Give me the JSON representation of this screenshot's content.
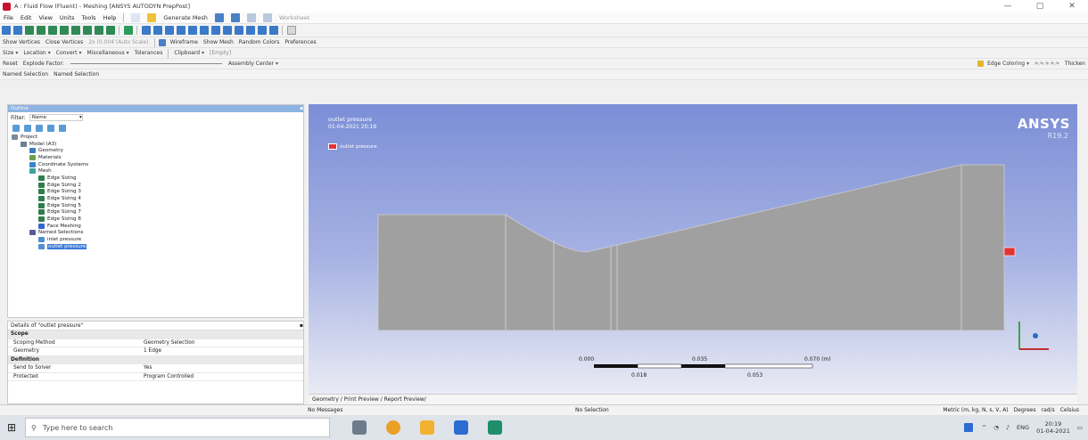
{
  "window": {
    "title": "A : Fluid Flow (Fluent) - Meshing [ANSYS AUTODYN PrepPost]",
    "controls": [
      "—",
      "▢",
      "✕"
    ]
  },
  "menubar": [
    "File",
    "Edit",
    "View",
    "Units",
    "Tools",
    "Help"
  ],
  "toolbar1": {
    "generate_mesh": "Generate Mesh",
    "worksheet": "Worksheet"
  },
  "toolbar3": {
    "show_vertices": "Show Vertices",
    "close_vertices": "Close Vertices",
    "auto_scale": "2x (0.004 (Auto Scale)",
    "wireframe": "Wireframe",
    "show_mesh": "Show Mesh",
    "random_colors": "Random Colors",
    "preferences": "Preferences"
  },
  "toolbar4": {
    "size": "Size",
    "location": "Location",
    "convert": "Convert",
    "miscellaneous": "Miscellaneous",
    "tolerances": "Tolerances",
    "clipboard": "Clipboard",
    "empty": "[Empty]"
  },
  "toolbar5": {
    "reset": "Reset",
    "explode_factor": "Explode Factor:",
    "assembly_center": "Assembly Center",
    "edge_coloring": "Edge Coloring",
    "thicken": "Thicken"
  },
  "named_selection_bar": {
    "named_selection": "Named Selection",
    "new_named_selection": "Named Selection"
  },
  "outline": {
    "title": "Outline",
    "filter_label": "Filter:",
    "filter_value": "Name",
    "tree": [
      {
        "label": "Project",
        "indent": 0,
        "icon": "project-icon",
        "color": "#7a8a9a"
      },
      {
        "label": "Model (A3)",
        "indent": 1,
        "icon": "model-icon",
        "color": "#6a7f95"
      },
      {
        "label": "Geometry",
        "indent": 2,
        "icon": "geometry-icon",
        "color": "#3d7bbf"
      },
      {
        "label": "Materials",
        "indent": 2,
        "icon": "materials-icon",
        "color": "#6f9e4f"
      },
      {
        "label": "Coordinate Systems",
        "indent": 2,
        "icon": "coordinate-icon",
        "color": "#3a86c9"
      },
      {
        "label": "Mesh",
        "indent": 2,
        "icon": "mesh-icon",
        "color": "#3aa39a"
      },
      {
        "label": "Edge Sizing",
        "indent": 3,
        "icon": "sizing-icon",
        "color": "#2f7d4a"
      },
      {
        "label": "Edge Sizing 2",
        "indent": 3,
        "icon": "sizing-icon",
        "color": "#2f7d4a"
      },
      {
        "label": "Edge Sizing 3",
        "indent": 3,
        "icon": "sizing-icon",
        "color": "#2f7d4a"
      },
      {
        "label": "Edge Sizing 4",
        "indent": 3,
        "icon": "sizing-icon",
        "color": "#2f7d4a"
      },
      {
        "label": "Edge Sizing 5",
        "indent": 3,
        "icon": "sizing-icon",
        "color": "#2f7d4a"
      },
      {
        "label": "Edge Sizing 7",
        "indent": 3,
        "icon": "sizing-icon",
        "color": "#2f7d4a"
      },
      {
        "label": "Edge Sizing 8",
        "indent": 3,
        "icon": "sizing-icon",
        "color": "#2f7d4a"
      },
      {
        "label": "Face Meshing",
        "indent": 3,
        "icon": "face-meshing-icon",
        "color": "#3366cc"
      },
      {
        "label": "Named Selections",
        "indent": 2,
        "icon": "named-selections-icon",
        "color": "#5a5a9a"
      },
      {
        "label": "inlet pressure",
        "indent": 3,
        "icon": "selection-icon",
        "color": "#4f8fd1"
      },
      {
        "label": "outlet pressure",
        "indent": 3,
        "icon": "selection-icon",
        "color": "#4f8fd1",
        "selected": true
      }
    ]
  },
  "details": {
    "title": "Details of \"outlet pressure\"",
    "rows": [
      {
        "section": true,
        "label": "Scope"
      },
      {
        "label": "Scoping Method",
        "value": "Geometry Selection"
      },
      {
        "label": "Geometry",
        "value": "1 Edge"
      },
      {
        "section": true,
        "label": "Definition"
      },
      {
        "label": "Send to Solver",
        "value": "Yes"
      },
      {
        "label": "Protected",
        "value": "Program Controlled"
      }
    ]
  },
  "viewport": {
    "title": "outlet pressure",
    "timestamp": "01-04-2021 20:19",
    "legend_label": "outlet pressure",
    "brand": "ANSYS",
    "version": "R19.2",
    "scale": {
      "top": [
        "0.000",
        "0.035",
        "0.070 (m)"
      ],
      "bottom": [
        "0.018",
        "0.053"
      ]
    },
    "colors": {
      "geometry": "#a0a0a0",
      "highlight": "#e23434",
      "axis_y": "#3ca34a",
      "axis_x": "#c03030",
      "axis_z": "#2d6cc0"
    }
  },
  "viewport_tabs": "Geometry / Print Preview / Report Preview/",
  "statusbar": {
    "messages": "No Messages",
    "selection": "No Selection",
    "units": "Metric (m, kg, N, s, V, A)",
    "degrees": "Degrees",
    "rad": "rad/s",
    "celsius": "Celsius"
  },
  "taskbar": {
    "search_placeholder": "Type here to search",
    "language": "ENG",
    "time": "20:19",
    "date": "01-04-2021"
  }
}
